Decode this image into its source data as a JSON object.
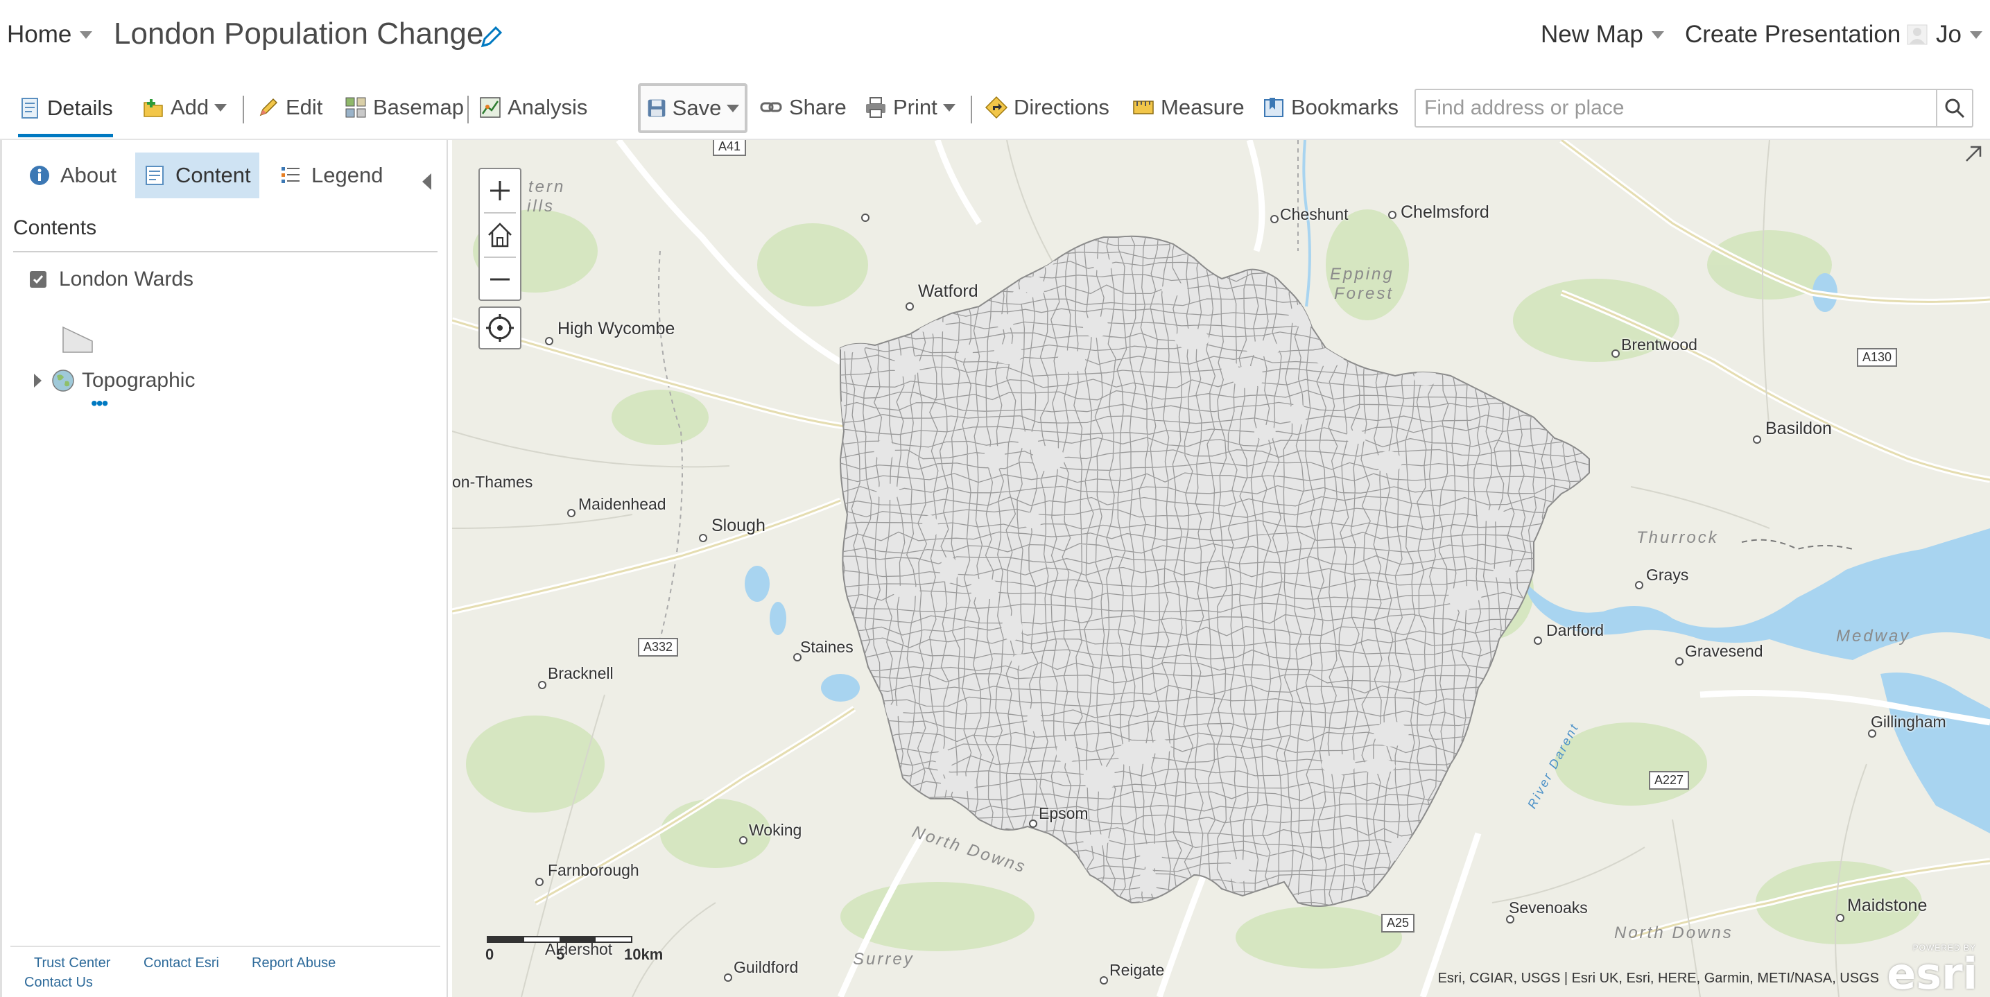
{
  "header": {
    "home_label": "Home",
    "map_title": "London Population Change",
    "new_map_label": "New Map",
    "create_presentation_label": "Create Presentation",
    "user_name": "Jo"
  },
  "toolbar": {
    "details_label": "Details",
    "add_label": "Add",
    "edit_label": "Edit",
    "basemap_label": "Basemap",
    "analysis_label": "Analysis",
    "save_label": "Save",
    "share_label": "Share",
    "print_label": "Print",
    "directions_label": "Directions",
    "measure_label": "Measure",
    "bookmarks_label": "Bookmarks",
    "search_placeholder": "Find address or place"
  },
  "panel": {
    "tabs": [
      {
        "label": "About",
        "active": false
      },
      {
        "label": "Content",
        "active": true
      },
      {
        "label": "Legend",
        "active": false
      }
    ],
    "contents_heading": "Contents",
    "layers": [
      {
        "label": "London Wards",
        "checked": true
      },
      {
        "label": "Topographic",
        "checked": false
      }
    ],
    "more_label": "•••",
    "footer_links": [
      "Trust Center",
      "Contact Esri",
      "Report Abuse",
      "Contact Us"
    ]
  },
  "map": {
    "places": [
      "Chelmsford",
      "Cheshunt",
      "Watford",
      "High Wycombe",
      "Brentwood",
      "Basildon",
      "on-Thames",
      "Maidenhead",
      "Slough",
      "Grays",
      "Dartford",
      "Gravesend",
      "Staines",
      "Bracknell",
      "Gillingham",
      "Epsom",
      "Woking",
      "Farnborough",
      "Sevenoaks",
      "Maidstone",
      "Guildford",
      "Reigate",
      "Aldershot"
    ],
    "regions": [
      "Epping",
      "Forest",
      "Thurrock",
      "Medway",
      "North Downs",
      "North Downs",
      "Surrey",
      "River Darent",
      "tern",
      "ills"
    ],
    "road_labels": [
      "A41",
      "A130",
      "A332",
      "A227",
      "A25"
    ],
    "scale_labels": [
      "0",
      "5",
      "10km"
    ],
    "attribution": "Esri, CGIAR, USGS | Esri UK, Esri, HERE, Garmin, METI/NASA, USGS",
    "logo_text": "esri",
    "logo_caption": "POWERED BY",
    "colors": {
      "ward_fill": "#e6e6e6",
      "ward_stroke": "#8a8a8a",
      "water": "#a8d4f0",
      "land": "#eeeee6",
      "accent": "#0079c1"
    }
  }
}
